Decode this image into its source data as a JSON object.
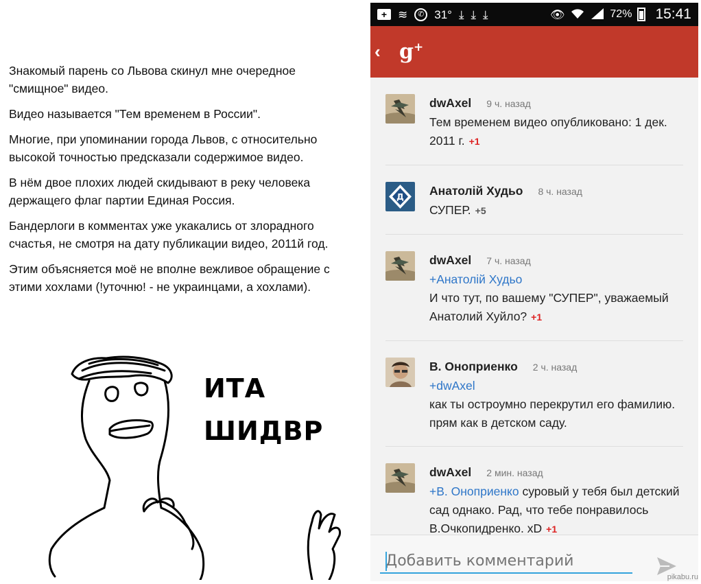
{
  "article": {
    "paragraphs": [
      "Знакомый парень со Львова скинул мне очередное \"смищное\" видео.",
      "Видео называется \"Тем временем в России\".",
      "Многие, при упоминании города Львов, с относительно высокой точностью предсказали содержимое видео.",
      "В нём двое плохих людей скидывают в реку человека держащего флаг партии Единая Россия.",
      "Бандерлоги в комментах уже укакались от злорадного счастья,  не смотря на дату публикации видео, 2011й год.",
      "Этим объясняется моё не вполне вежливое обращение с этими хохлами (!уточню! - не украинцами, а хохлами)."
    ]
  },
  "meme": {
    "line1": "ИТА",
    "line2": "ШИДВР"
  },
  "statusbar": {
    "temp": "31°",
    "battery": "72%",
    "time": "15:41"
  },
  "appbar": {
    "back": "‹",
    "logo": "g",
    "logo_plus": "+"
  },
  "comments": [
    {
      "author": "dwAxel",
      "ago": "9 ч. назад",
      "mention": "",
      "text": "Тем временем видео опубликовано: 1 дек. 2011 г.",
      "plus": "+1",
      "plus_color": "red",
      "avatar": "axel"
    },
    {
      "author": "Анатолій Худьо",
      "ago": "8 ч. назад",
      "mention": "",
      "text": "СУПЕР.",
      "plus": "+5",
      "plus_color": "gray",
      "avatar": "dynamo"
    },
    {
      "author": "dwAxel",
      "ago": "7 ч. назад",
      "mention": "+Анатолій Худьо",
      "text": "И что тут, по вашему \"СУПЕР\",  уважаемый Анатолий Хуйло?",
      "plus": "+1",
      "plus_color": "red",
      "avatar": "axel"
    },
    {
      "author": "В. Оноприенко",
      "ago": "2 ч. назад",
      "mention": "+dwAxel",
      "text": "как ты остроумно перекрутил его фамилию. прям как в детском саду.",
      "plus": "",
      "plus_color": "red",
      "avatar": "face"
    },
    {
      "author": "dwAxel",
      "ago": "2 мин. назад",
      "mention": "+В. Оноприенко",
      "text": "суровый у тебя был детский сад однако. Рад, что тебе понравилось В.Очкопидренко. xD",
      "plus": "+1",
      "plus_color": "red",
      "avatar": "axel",
      "inline_mention": true
    }
  ],
  "composer": {
    "placeholder": "Добавить комментарий"
  },
  "watermark": "pikabu.ru"
}
